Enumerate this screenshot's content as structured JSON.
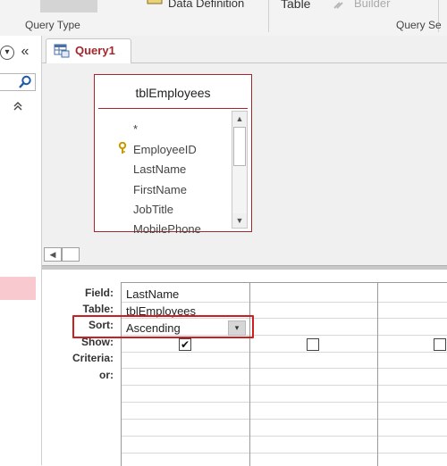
{
  "ribbon": {
    "group_query_type": "Query Type",
    "group_query_setup": "Query Se",
    "data_definition": "Data Definition",
    "table_label": "Table",
    "builder_label": "Builder"
  },
  "nav": {
    "dropdown_glyph": "▾",
    "collapse_glyph": "«",
    "search_glyph": "⚲",
    "expand_up_glyph": "⌃"
  },
  "document_tab": {
    "label": "Query1",
    "icon": "query-design-icon"
  },
  "table_box": {
    "title": "tblEmployees",
    "fields": [
      "*",
      "EmployeeID",
      "LastName",
      "FirstName",
      "JobTitle",
      "MobilePhone"
    ],
    "primary_key_field": "EmployeeID",
    "key_icon": "🔑"
  },
  "design_grid": {
    "row_labels": {
      "field": "Field:",
      "table": "Table:",
      "sort": "Sort:",
      "show": "Show:",
      "criteria": "Criteria:",
      "or": "or:"
    },
    "columns": [
      {
        "field": "LastName",
        "table": "tblEmployees",
        "sort": "Ascending",
        "show": true
      },
      {
        "field": "",
        "table": "",
        "sort": "",
        "show": false
      },
      {
        "field": "",
        "table": "",
        "sort": "",
        "show": false
      }
    ],
    "check_glyph": "✔",
    "dropdown_glyph": "▾"
  },
  "colors": {
    "accent": "#a4262c",
    "highlight": "#cc1f1f",
    "nav_selection": "#f8c9cf"
  }
}
